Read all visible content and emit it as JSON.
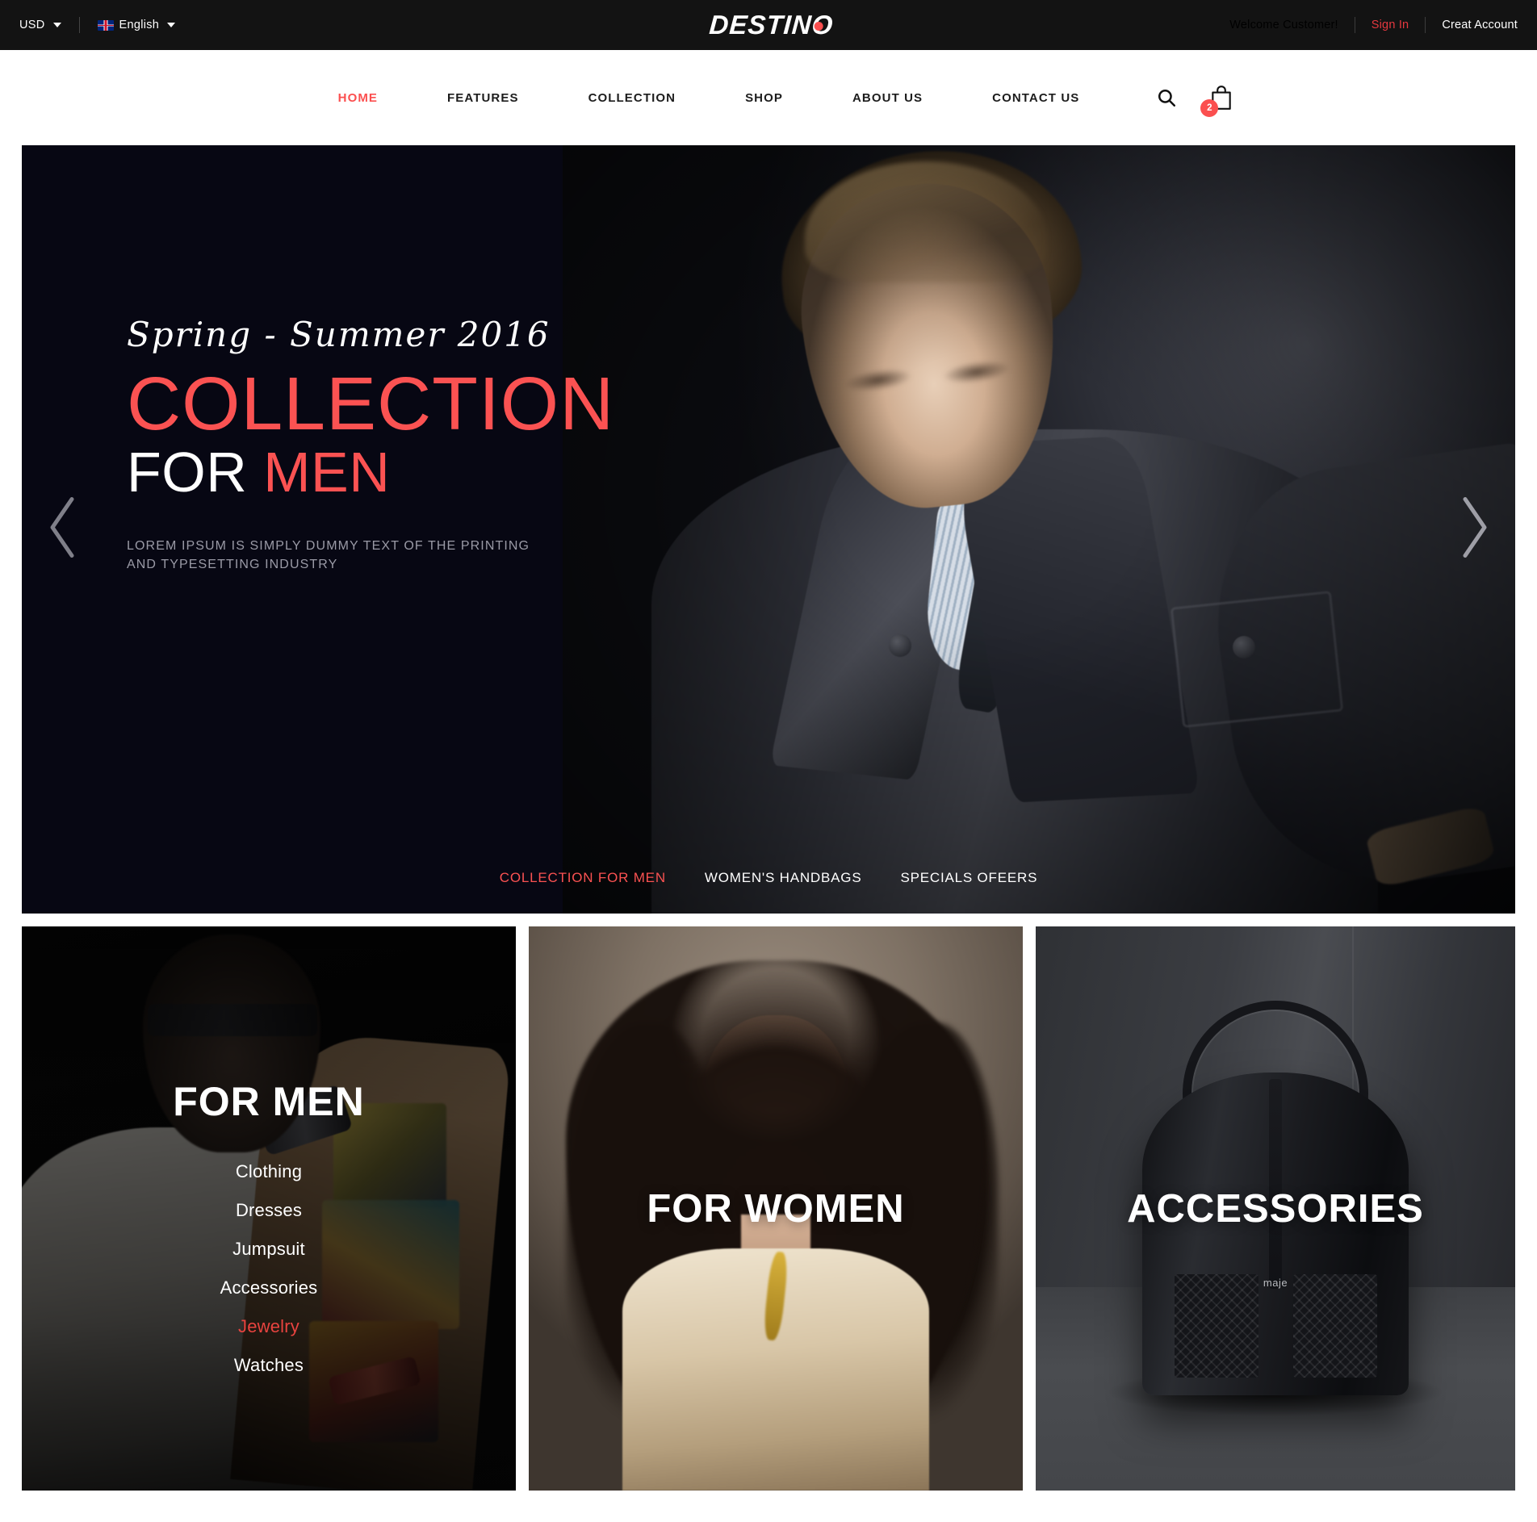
{
  "topbar": {
    "currency": "USD",
    "language": "English",
    "language_flag_icon": "uk-flag-icon",
    "welcome": "Welcome Customer!",
    "sign_in": "Sign In",
    "create_account": "Creat Account",
    "logo": "DESTINO",
    "accent_color": "#fb4f4f",
    "signin_color": "#e5383f",
    "background": "#131313"
  },
  "nav": {
    "items": [
      {
        "label": "HOME",
        "active": true
      },
      {
        "label": "FEATURES",
        "active": false
      },
      {
        "label": "COLLECTION",
        "active": false
      },
      {
        "label": "SHOP",
        "active": false
      },
      {
        "label": "ABOUT US",
        "active": false
      },
      {
        "label": "CONTACT US",
        "active": false
      }
    ],
    "search_icon": "search-icon",
    "cart_icon": "shopping-bag-icon",
    "cart_count": "2"
  },
  "hero": {
    "season": "Spring - Summer 2016",
    "headline": "COLLECTION",
    "subhead_white": "FOR",
    "subhead_red": "MEN",
    "description_line1": "LOREM IPSUM IS SIMPLY DUMMY TEXT OF THE PRINTING",
    "description_line2": "AND TYPESETTING INDUSTRY",
    "prev_icon": "chevron-left-icon",
    "next_icon": "chevron-right-icon",
    "tabs": [
      {
        "label": "COLLECTION FOR MEN",
        "active": true
      },
      {
        "label": "WOMEN'S HANDBAGS",
        "active": false
      },
      {
        "label": "SPECIALS OFEERS",
        "active": false
      }
    ],
    "background": "#070713",
    "accent_color": "#fb5252"
  },
  "cards": {
    "men": {
      "title": "FOR MEN",
      "links": [
        {
          "label": "Clothing",
          "highlight": false
        },
        {
          "label": "Dresses",
          "highlight": false
        },
        {
          "label": "Jumpsuit",
          "highlight": false
        },
        {
          "label": "Accessories",
          "highlight": false
        },
        {
          "label": "Jewelry",
          "highlight": true
        },
        {
          "label": "Watches",
          "highlight": false
        }
      ],
      "highlight_color": "#e8433f"
    },
    "women": {
      "title": "FOR WOMEN"
    },
    "accessories": {
      "title": "ACCESSORIES",
      "bag_brand": "maje"
    }
  }
}
